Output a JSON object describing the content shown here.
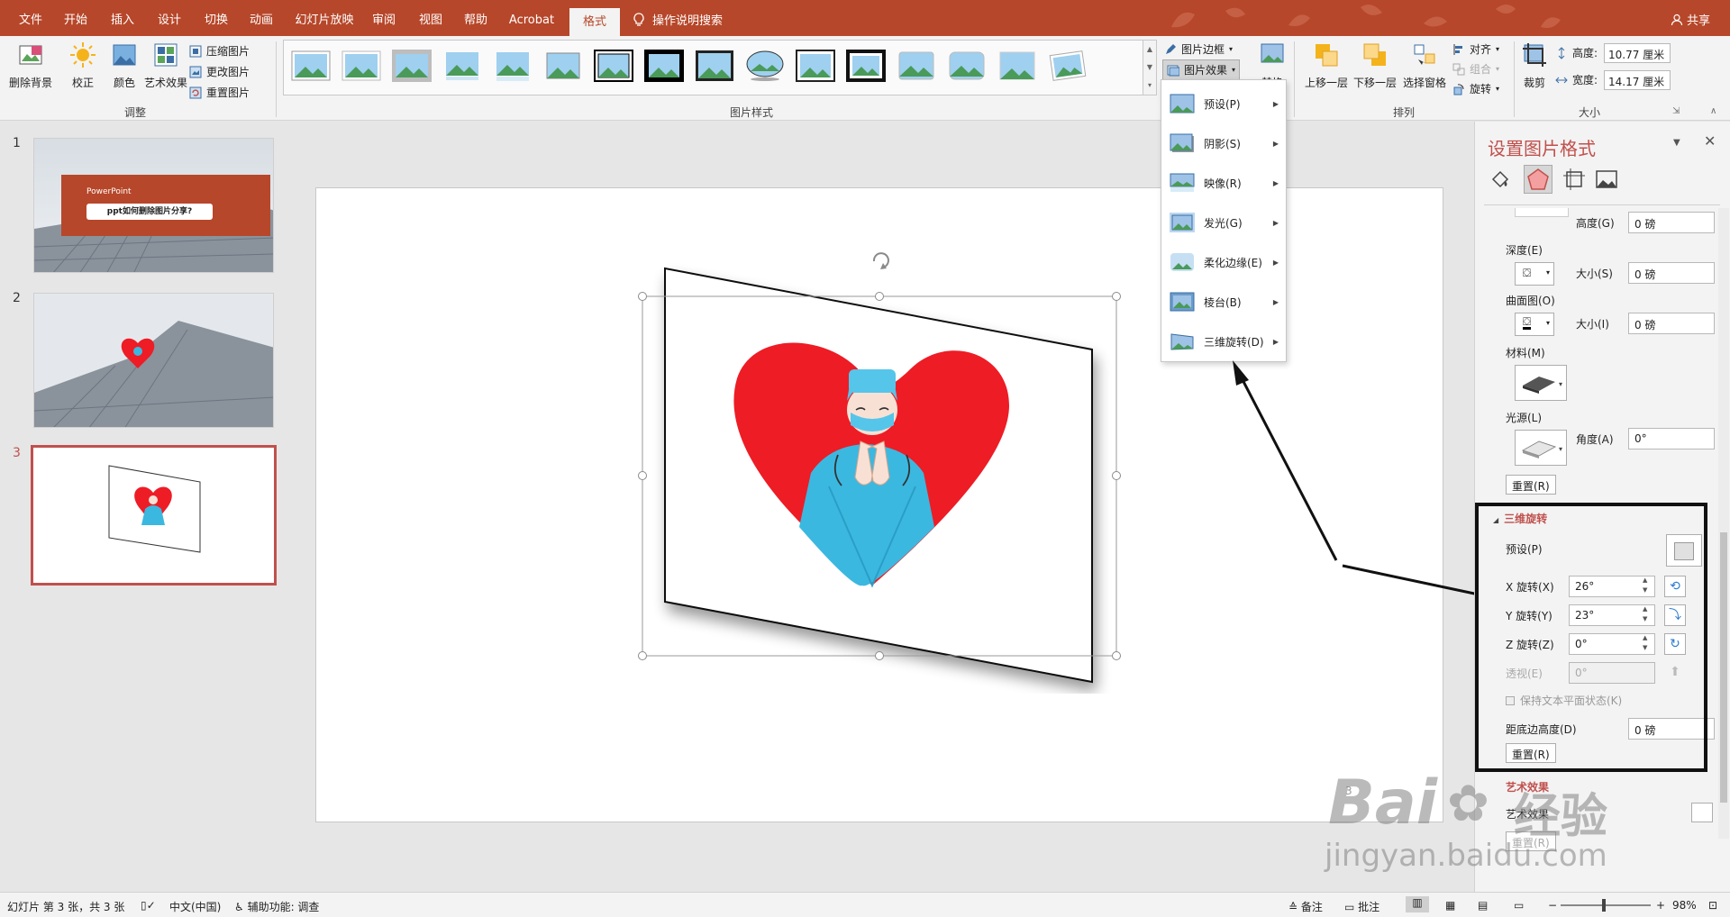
{
  "tabs": [
    "文件",
    "开始",
    "插入",
    "设计",
    "切换",
    "动画",
    "幻灯片放映",
    "审阅",
    "视图",
    "帮助",
    "Acrobat",
    "格式"
  ],
  "active_tab": "格式",
  "tell_me": "操作说明搜索",
  "share": "共享",
  "ribbon": {
    "remove_bg": "删除背景",
    "correct": "校正",
    "color": "颜色",
    "art_effects": "艺术效果",
    "compress": "压缩图片",
    "change": "更改图片",
    "reset": "重置图片",
    "group_adjust": "调整",
    "group_styles": "图片样式",
    "border": "图片边框",
    "effects": "图片效果",
    "replace": "替换",
    "bring_forward": "上移一层",
    "send_backward": "下移一层",
    "selection_pane": "选择窗格",
    "align": "对齐",
    "group": "组合",
    "rotate": "旋转",
    "group_arrange": "排列",
    "crop": "裁剪",
    "height_label": "高度:",
    "height_value": "10.77 厘米",
    "width_label": "宽度:",
    "width_value": "14.17 厘米",
    "group_size": "大小"
  },
  "effects_menu": [
    "预设(P)",
    "阴影(S)",
    "映像(R)",
    "发光(G)",
    "柔化边缘(E)",
    "棱台(B)",
    "三维旋转(D)"
  ],
  "slides": [
    {
      "num": "1",
      "title_text": "PowerPoint",
      "subtitle": "ppt如何删除图片分享?"
    },
    {
      "num": "2"
    },
    {
      "num": "3"
    }
  ],
  "slide_number": "3",
  "format_pane": {
    "title": "设置图片格式",
    "height_label": "高度(G)",
    "height_value": "0 磅",
    "depth_label": "深度(E)",
    "depth_size_label": "大小(S)",
    "depth_size_value": "0 磅",
    "contour_label": "曲面图(O)",
    "contour_size_label": "大小(I)",
    "contour_size_value": "0 磅",
    "material_label": "材料(M)",
    "lighting_label": "光源(L)",
    "angle_label": "角度(A)",
    "angle_value": "0°",
    "reset1": "重置(R)",
    "rot_section": "三维旋转",
    "preset_label": "预设(P)",
    "x_label": "X 旋转(X)",
    "x_value": "26°",
    "y_label": "Y 旋转(Y)",
    "y_value": "23°",
    "z_label": "Z 旋转(Z)",
    "z_value": "0°",
    "persp_label": "透视(E)",
    "persp_value": "0°",
    "keep_flat": "保持文本平面状态(K)",
    "dist_label": "距底边高度(D)",
    "dist_value": "0 磅",
    "reset2": "重置(R)",
    "art_section": "艺术效果",
    "art_label": "艺术效果",
    "reset3": "重置(R)"
  },
  "status": {
    "slide_info": "幻灯片 第 3 张，共 3 张",
    "language": "中文(中国)",
    "accessibility": "辅助功能: 调查",
    "notes": "备注",
    "comments": "批注",
    "zoom": "98%"
  },
  "watermark": {
    "brand": "Bai",
    "brand2": "经验",
    "url": "jingyan.baidu.com"
  },
  "colors": {
    "accent": "#b7472a",
    "pane_title": "#c0504d",
    "heart": "#ee1c25",
    "nurse": "#3bb8e0"
  }
}
